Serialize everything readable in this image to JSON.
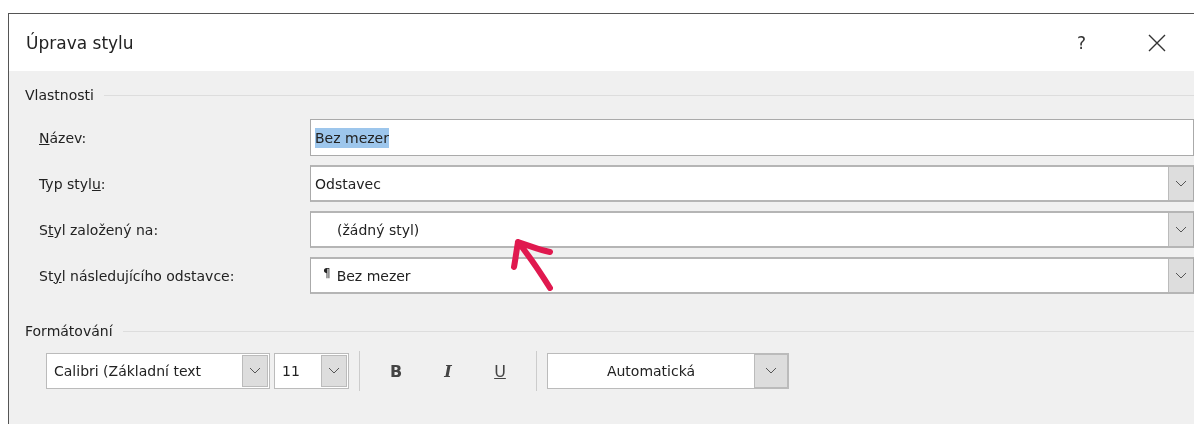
{
  "window": {
    "title": "Úprava stylu",
    "help_button": "?"
  },
  "properties": {
    "heading": "Vlastnosti",
    "fields": [
      {
        "kind": "text",
        "label": [
          {
            "text": "N",
            "underline": true
          },
          {
            "text": "ázev:",
            "underline": false
          }
        ],
        "value": "Bez mezer",
        "value_selected": true
      },
      {
        "kind": "dropdown",
        "label": [
          {
            "text": "Typ styl",
            "underline": false
          },
          {
            "text": "u",
            "underline": true
          },
          {
            "text": ":",
            "underline": false
          }
        ],
        "value": "Odstavec"
      },
      {
        "kind": "dropdown",
        "label": [
          {
            "text": "S",
            "underline": false
          },
          {
            "text": "t",
            "underline": true
          },
          {
            "text": "yl založený na:",
            "underline": false
          }
        ],
        "value": "(žádný styl)"
      },
      {
        "kind": "dropdown",
        "label": [
          {
            "text": "St",
            "underline": false
          },
          {
            "text": "y",
            "underline": true
          },
          {
            "text": "l následujícího odstavce:",
            "underline": false
          }
        ],
        "value": "Bez mezer",
        "symbol": "¶"
      }
    ]
  },
  "formatting": {
    "heading": "Formátování",
    "font": "Calibri (Základní text",
    "size": "11",
    "bold": "B",
    "italic": "I",
    "underline": "U",
    "font_color": "Automatická"
  }
}
